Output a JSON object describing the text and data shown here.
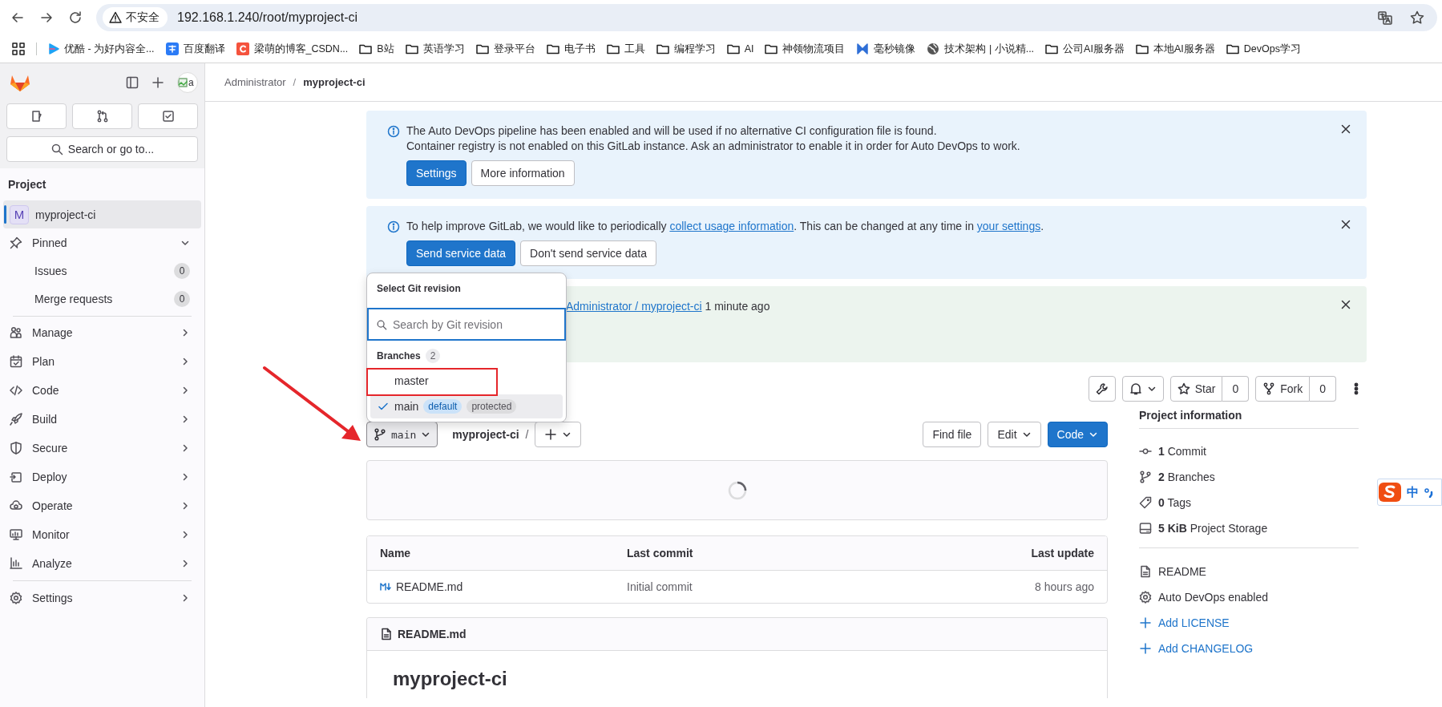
{
  "browser": {
    "security_label": "不安全",
    "url": "192.168.1.240/root/myproject-ci",
    "bookmarks": [
      {
        "label": "优酷 - 为好内容全...",
        "kind": "play"
      },
      {
        "label": "百度翻译",
        "kind": "translate"
      },
      {
        "label": "梁萌的博客_CSDN...",
        "kind": "letter"
      },
      {
        "label": "B站",
        "kind": "folder"
      },
      {
        "label": "英语学习",
        "kind": "folder"
      },
      {
        "label": "登录平台",
        "kind": "folder"
      },
      {
        "label": "电子书",
        "kind": "folder"
      },
      {
        "label": "工具",
        "kind": "folder"
      },
      {
        "label": "编程学习",
        "kind": "folder"
      },
      {
        "label": "AI",
        "kind": "folder"
      },
      {
        "label": "神领物流项目",
        "kind": "folder"
      },
      {
        "label": "毫秒镜像",
        "kind": "mirror"
      },
      {
        "label": "技术架构 | 小说精...",
        "kind": "globe"
      },
      {
        "label": "公司AI服务器",
        "kind": "folder"
      },
      {
        "label": "本地AI服务器",
        "kind": "folder"
      },
      {
        "label": "DevOps学习",
        "kind": "folder"
      }
    ]
  },
  "sidebar": {
    "avatar_alt": "a",
    "search": "Search or go to...",
    "section": "Project",
    "project": {
      "initial": "M",
      "name": "myproject-ci",
      "selected": true
    },
    "pinned": {
      "label": "Pinned",
      "expanded": true,
      "items": [
        {
          "label": "Issues",
          "count": "0"
        },
        {
          "label": "Merge requests",
          "count": "0"
        }
      ]
    },
    "groups": [
      {
        "label": "Manage",
        "kind": "people"
      },
      {
        "label": "Plan",
        "kind": "calendar"
      },
      {
        "label": "Code",
        "kind": "code"
      },
      {
        "label": "Build",
        "kind": "rocket"
      },
      {
        "label": "Secure",
        "kind": "shield"
      },
      {
        "label": "Deploy",
        "kind": "deploy"
      },
      {
        "label": "Operate",
        "kind": "cloud"
      },
      {
        "label": "Monitor",
        "kind": "monitor"
      },
      {
        "label": "Analyze",
        "kind": "chart"
      }
    ],
    "footer_items": [
      {
        "label": "Settings",
        "kind": "gear"
      }
    ]
  },
  "breadcrumb": {
    "items": [
      "Administrator",
      "myproject-ci"
    ],
    "separator": "/"
  },
  "notices": [
    {
      "kind": "info",
      "lines": [
        "The Auto DevOps pipeline has been enabled and will be used if no alternative CI configuration file is found.",
        "Container registry is not enabled on this GitLab instance. Ask an administrator to enable it in order for Auto DevOps to work."
      ],
      "buttons": [
        {
          "label": "Settings",
          "primary": true
        },
        {
          "label": "More information",
          "primary": false
        }
      ]
    },
    {
      "kind": "info",
      "parts": [
        {
          "text": "To help improve GitLab, we would like to periodically ",
          "link": false
        },
        {
          "text": "collect usage information",
          "link": true
        },
        {
          "text": ". This can be changed at any time in ",
          "link": false
        },
        {
          "text": "your settings",
          "link": true
        },
        {
          "text": ".",
          "link": false
        }
      ],
      "buttons": [
        {
          "label": "Send service data",
          "primary": true
        },
        {
          "label": "Don't send service data",
          "primary": false
        }
      ]
    },
    {
      "kind": "success",
      "parts": [
        {
          "text": "Administrator / myproject-ci",
          "link": true
        },
        {
          "text": " 1 minute ago",
          "link": false
        }
      ]
    }
  ],
  "project_actions": {
    "star": {
      "label": "Star",
      "count": "0"
    },
    "fork": {
      "label": "Fork",
      "count": "0"
    }
  },
  "revision_dropdown": {
    "title": "Select Git revision",
    "search_placeholder": "Search by Git revision",
    "section": "Branches",
    "section_count": "2",
    "items": [
      {
        "name": "master",
        "selected": false
      },
      {
        "name": "main",
        "selected": true,
        "badges": [
          {
            "label": "default",
            "kind": "info"
          },
          {
            "label": "protected",
            "kind": "neutral"
          }
        ]
      }
    ]
  },
  "repo_bar": {
    "branch": "main",
    "path": "myproject-ci",
    "separator": "/",
    "actions": [
      {
        "label": "Find file",
        "kind": "plain"
      },
      {
        "label": "Edit",
        "kind": "menu"
      },
      {
        "label": "Code",
        "kind": "primary"
      }
    ]
  },
  "loading": true,
  "files": {
    "columns": [
      "Name",
      "Last commit",
      "Last update"
    ],
    "rows": [
      {
        "name": "README.md",
        "commit": "Initial commit",
        "updated": "8 hours ago"
      }
    ]
  },
  "readme": {
    "filename": "README.md",
    "heading": "myproject-ci"
  },
  "project_info": {
    "title": "Project information",
    "stats": [
      {
        "text": "**1** Commit",
        "kind": "commit"
      },
      {
        "text": "**2** Branches",
        "kind": "branch"
      },
      {
        "text": "**0** Tags",
        "kind": "tag"
      },
      {
        "text": "**5 KiB** Project Storage",
        "kind": "storage"
      }
    ],
    "links": [
      {
        "label": "README",
        "kind": "file"
      },
      {
        "label": "Auto DevOps enabled",
        "kind": "gear"
      },
      {
        "label": "Add LICENSE",
        "kind": "add"
      },
      {
        "label": "Add CHANGELOG",
        "kind": "add"
      }
    ]
  },
  "ime": {
    "mode": "中"
  }
}
